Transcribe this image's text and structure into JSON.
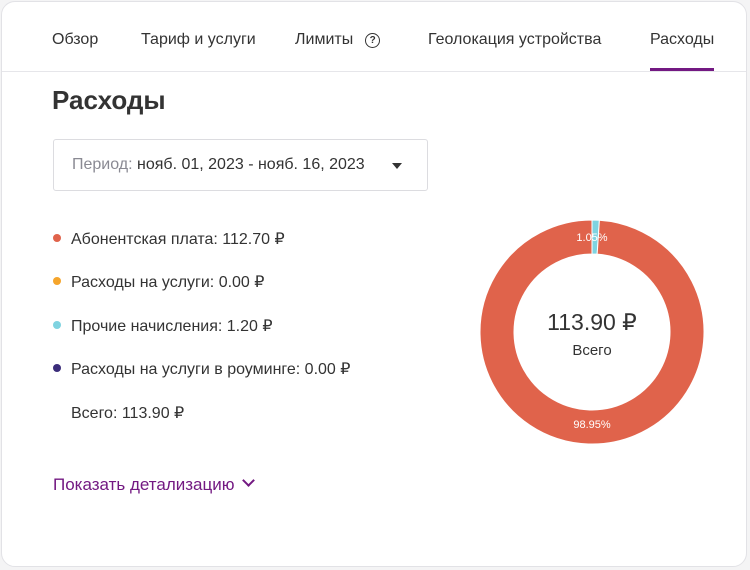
{
  "tabs": [
    {
      "label": "Обзор",
      "active": false
    },
    {
      "label": "Тариф и услуги",
      "active": false
    },
    {
      "label": "Лимиты",
      "active": false,
      "help_icon": "question-circle-icon"
    },
    {
      "label": "Геолокация устройства",
      "active": false
    },
    {
      "label": "Расходы",
      "active": true
    }
  ],
  "page_title": "Расходы",
  "period": {
    "label": "Период:",
    "value": "нояб. 01, 2023 - нояб. 16, 2023",
    "icon": "caret-down-icon"
  },
  "legend": [
    {
      "text": "Абонентская плата: 112.70 ₽",
      "color": "#e0634b"
    },
    {
      "text": "Расходы на услуги: 0.00 ₽",
      "color": "#f5a52c"
    },
    {
      "text": "Прочие начисления: 1.20 ₽",
      "color": "#7fd3e0"
    },
    {
      "text": "Расходы на услуги в роуминге: 0.00 ₽",
      "color": "#3b2d7a"
    }
  ],
  "total_line": "Всего: 113.90 ₽",
  "details_link": "Показать детализацию",
  "colors": {
    "accent": "#731982",
    "text": "#333333"
  },
  "chart_data": {
    "type": "pie",
    "center_value": "113.90 ₽",
    "center_label": "Всего",
    "slices": [
      {
        "label": "Прочие начисления",
        "value": 1.2,
        "percent_label": "1.05%",
        "color": "#7fd3e0"
      },
      {
        "label": "Абонентская плата",
        "value": 112.7,
        "percent_label": "98.95%",
        "color": "#e0634b"
      }
    ]
  }
}
